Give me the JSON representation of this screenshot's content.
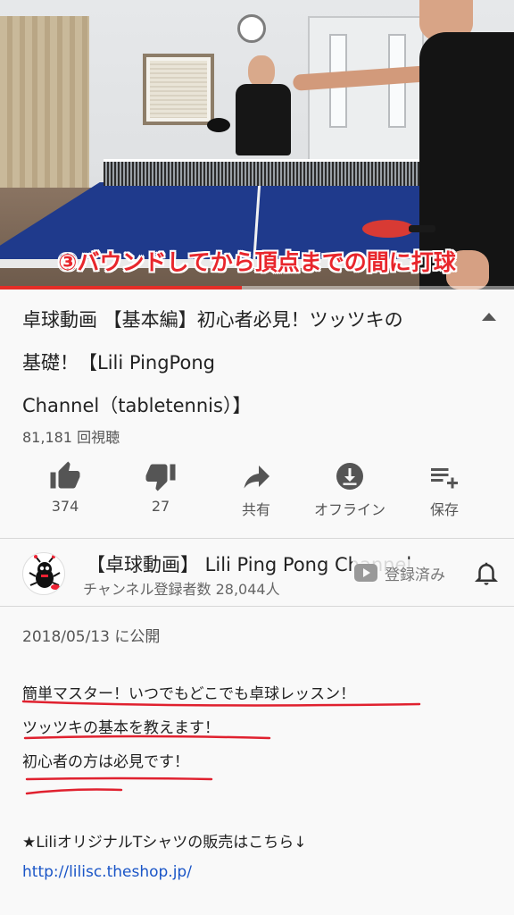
{
  "video": {
    "caption": "③バウンドしてから頂点までの間に打球",
    "progress_percent": 47
  },
  "info": {
    "title_line1": "卓球動画 【基本編】初心者必見！ツッツキの",
    "title_line2": "基礎！【Lili PingPong",
    "title_line3": "Channel（tabletennis）】",
    "views": "81,181 回視聴"
  },
  "actions": {
    "like": {
      "label": "374",
      "icon": "thumbs-up-icon"
    },
    "dislike": {
      "label": "27",
      "icon": "thumbs-down-icon"
    },
    "share": {
      "label": "共有",
      "icon": "share-icon"
    },
    "offline": {
      "label": "オフライン",
      "icon": "download-icon"
    },
    "save": {
      "label": "保存",
      "icon": "playlist-add-icon"
    }
  },
  "channel": {
    "name": "【卓球動画】 Lili Ping Pong Channel",
    "subscribers": "チャンネル登録者数 28,044人",
    "subscribe_state": "登録済み"
  },
  "description": {
    "published": "2018/05/13 に公開",
    "lines": [
      "簡単マスター！いつでもどこでも卓球レッスン！",
      "ツッツキの基本を教えます！",
      "初心者の方は必見です！",
      "★LiliオリジナルTシャツの販売はこちら↓"
    ],
    "link": "http://lilisc.theshop.jp/"
  },
  "colors": {
    "caption_red": "#e8262c",
    "progress_red": "#e52d27",
    "link_blue": "#1a55c7",
    "annotation_red": "#e0212f"
  }
}
